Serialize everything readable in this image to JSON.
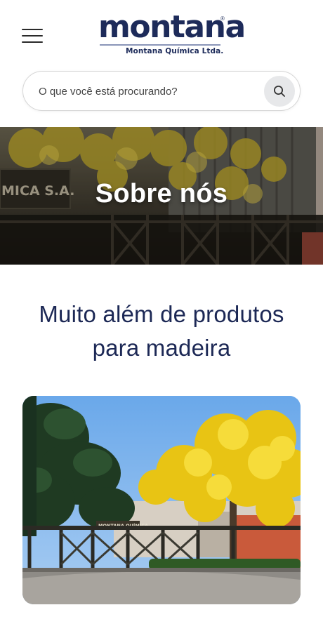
{
  "header": {
    "brand_name": "montana",
    "brand_registered": "®",
    "brand_subtitle": "Montana Química Ltda."
  },
  "search": {
    "placeholder": "O que você está procurando?"
  },
  "hero": {
    "title": "Sobre nós",
    "sign_text": "MICA S.A."
  },
  "intro": {
    "heading_line1": "Muito além de produtos",
    "heading_line2": "para madeira"
  },
  "photo": {
    "sign_text": "MONTANA QUÍMICA"
  },
  "icons": {
    "menu": "hamburger-menu-icon",
    "search": "search-icon"
  },
  "colors": {
    "brand_navy": "#1c2855",
    "search_button_bg": "#e7e8ea",
    "tree_yellow": "#f2d21b"
  }
}
